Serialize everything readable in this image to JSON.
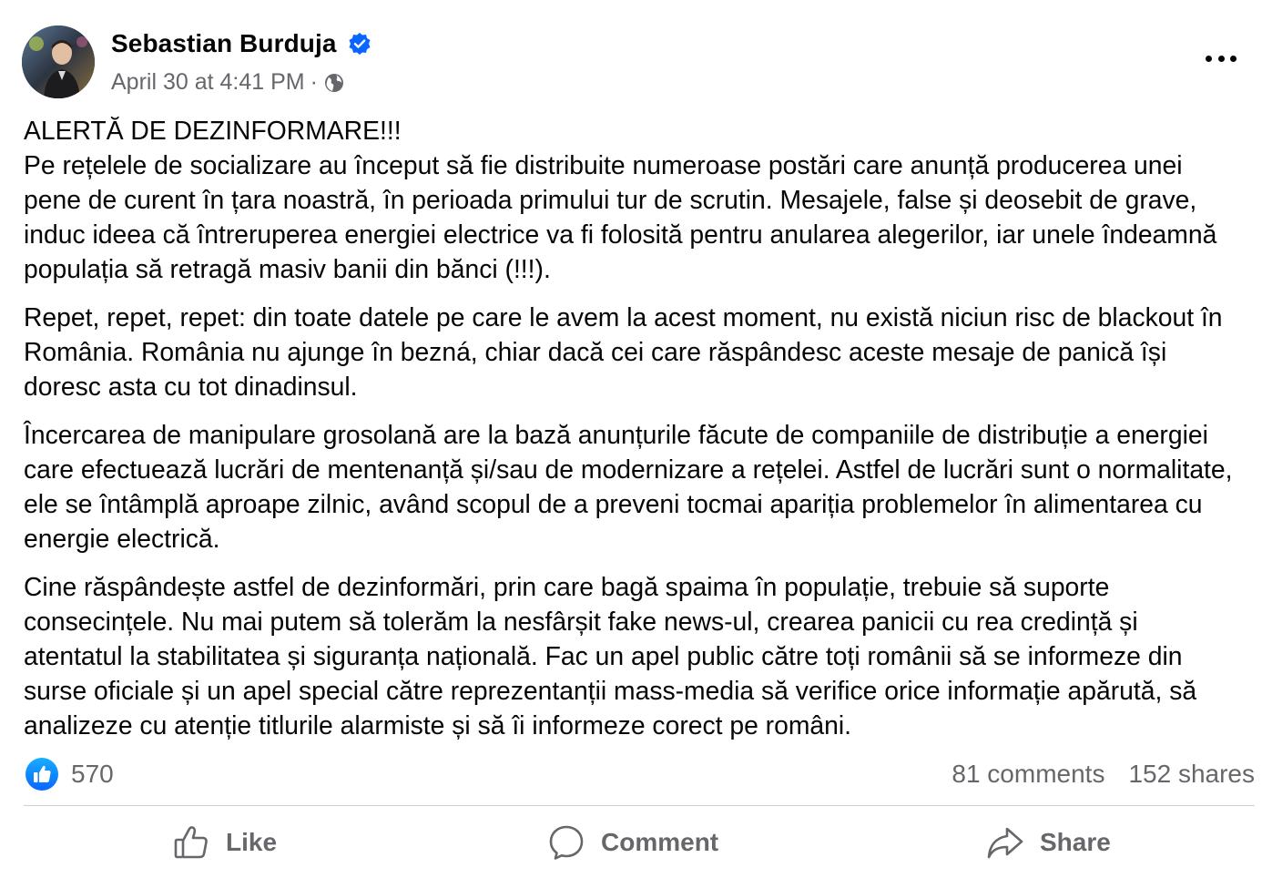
{
  "post": {
    "author": {
      "name": "Sebastian Burduja",
      "verified": true,
      "avatar_icon": "profile-photo"
    },
    "timestamp": "April 30 at 4:41 PM",
    "separator": "·",
    "audience_icon": "globe-icon",
    "more_icon": "more-options-icon",
    "paragraphs": [
      "ALERTĂ DE DEZINFORMARE!!!\nPe rețelele de socializare au început să fie distribuite numeroase postări care anunță producerea unei pene de curent în țara noastră, în perioada primului tur de scrutin. Mesajele, false și deosebit de grave, induc ideea că întreruperea energiei electrice va fi folosită pentru anularea alegerilor, iar unele îndeamnă populația să retragă masiv banii din bănci (!!!).",
      "Repet, repet, repet: din toate datele pe care le avem la acest moment, nu există niciun risc de blackout în România. România nu ajunge în bezná, chiar dacă cei care răspândesc aceste mesaje de panică își doresc asta cu tot dinadinsul.",
      "Încercarea de manipulare grosolană are la bază anunțurile făcute de companiile de distribuție a energiei care efectuează lucrări de mentenanță și/sau de modernizare a rețelei. Astfel de lucrări sunt o normalitate, ele se întâmplă aproape zilnic, având scopul de a preveni tocmai apariția problemelor în alimentarea cu energie electrică.",
      "Cine răspândește astfel de dezinformări, prin care bagă spaima în populație, trebuie să suporte consecințele. Nu mai putem să tolerăm la nesfârșit fake news-ul, crearea panicii cu rea credință și atentatul la stabilitatea și siguranța națională. Fac un apel public către toți românii să se informeze din surse oficiale și un apel special către reprezentanții mass-media să verifice orice informație apărută, să analizeze cu atenție titlurile alarmiste și să îi informeze corect pe români."
    ],
    "stats": {
      "reactions": "570",
      "comments": "81 comments",
      "shares": "152 shares"
    },
    "actions": {
      "like": "Like",
      "comment": "Comment",
      "share": "Share"
    }
  },
  "colors": {
    "text": "#050505",
    "secondary_text": "#65676b",
    "brand_blue": "#0866ff",
    "divider": "#ced0d4"
  }
}
